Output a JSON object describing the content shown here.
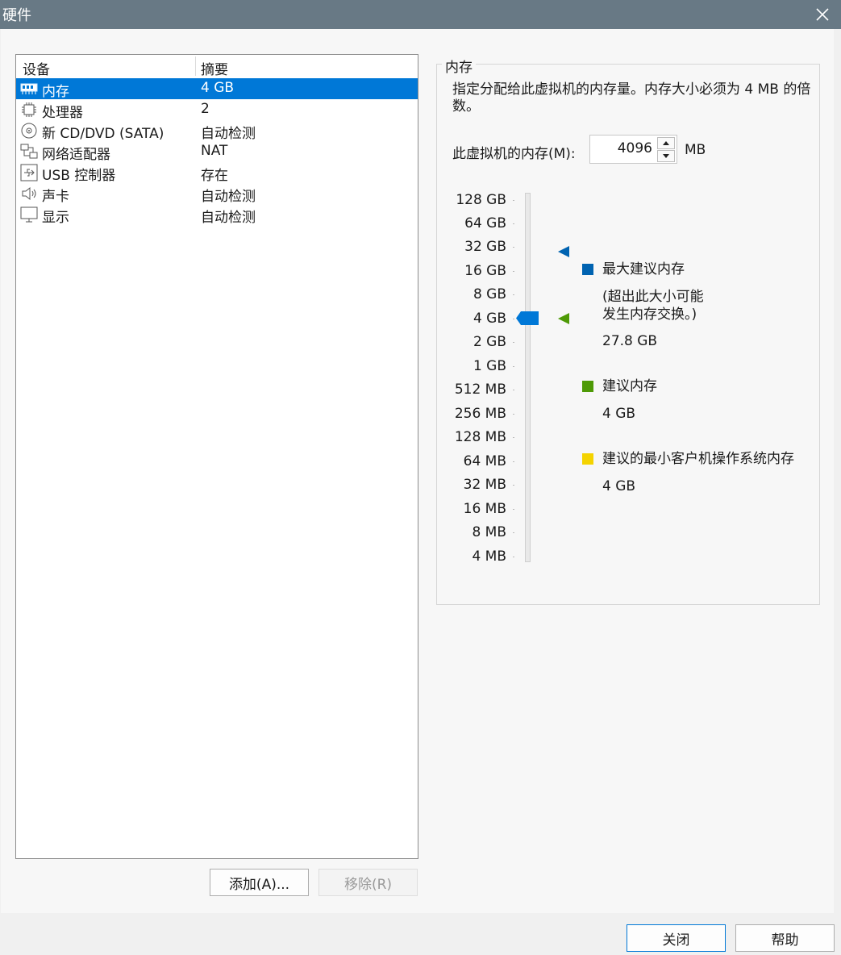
{
  "window": {
    "title": "硬件",
    "close_icon": "close-icon"
  },
  "device_list": {
    "col_device": "设备",
    "col_summary": "摘要",
    "rows": [
      {
        "name": "内存",
        "summary": "4 GB",
        "icon": "memory-icon",
        "selected": true
      },
      {
        "name": "处理器",
        "summary": "2",
        "icon": "processor-icon"
      },
      {
        "name": "新 CD/DVD (SATA)",
        "summary": "自动检测",
        "icon": "cd-dvd-icon"
      },
      {
        "name": "网络适配器",
        "summary": "NAT",
        "icon": "network-adapter-icon"
      },
      {
        "name": "USB 控制器",
        "summary": "存在",
        "icon": "usb-icon"
      },
      {
        "name": "声卡",
        "summary": "自动检测",
        "icon": "speaker-icon"
      },
      {
        "name": "显示",
        "summary": "自动检测",
        "icon": "display-icon"
      }
    ]
  },
  "buttons": {
    "add": "添加(A)...",
    "remove": "移除(R)",
    "close": "关闭",
    "help": "帮助"
  },
  "memory": {
    "group_title": "内存",
    "description": "指定分配给此虚拟机的内存量。内存大小必须为 4 MB 的倍数。",
    "field_label": "此虚拟机的内存(M):",
    "value": "4096",
    "unit": "MB",
    "scale_labels": [
      "128 GB",
      "64 GB",
      "32 GB",
      "16 GB",
      "8 GB",
      "4 GB",
      "2 GB",
      "1 GB",
      "512 MB",
      "256 MB",
      "128 MB",
      "64 MB",
      "32 MB",
      "16 MB",
      "8 MB",
      "4 MB"
    ],
    "slider_value": "4 GB",
    "legend": {
      "max": {
        "title": "最大建议内存",
        "note_line1": "(超出此大小可能",
        "note_line2": "发生内存交换。)",
        "value": "27.8 GB",
        "color": "#0063b1"
      },
      "recommended": {
        "title": "建议内存",
        "value": "4 GB",
        "color": "#4e9a06"
      },
      "min_guest": {
        "title": "建议的最小客户机操作系统内存",
        "value": "4 GB",
        "color": "#f4d300"
      }
    }
  }
}
